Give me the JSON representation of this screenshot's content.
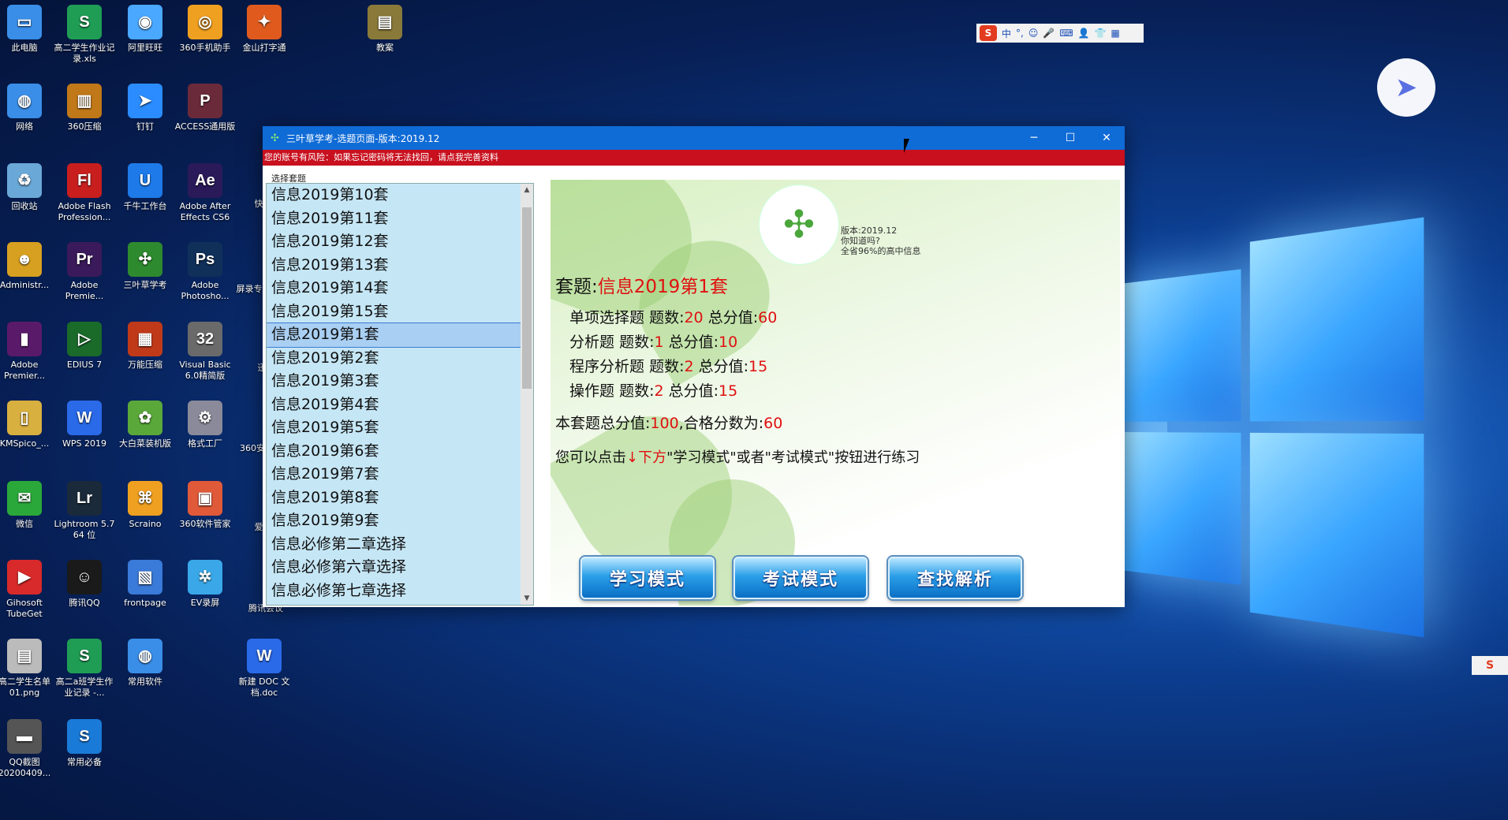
{
  "desktop": {
    "icons": [
      {
        "label": "此电脑",
        "color": "#3a8ee8",
        "glyph": "▭"
      },
      {
        "label": "高二学生作业记录.xls",
        "color": "#1f9d55",
        "glyph": "S"
      },
      {
        "label": "阿里旺旺",
        "color": "#4aa8ff",
        "glyph": "◉"
      },
      {
        "label": "360手机助手",
        "color": "#f0a020",
        "glyph": "◎"
      },
      {
        "label": "金山打字通",
        "color": "#e05a1e",
        "glyph": "✦"
      },
      {
        "label": "教案",
        "color": "#8a7a3a",
        "glyph": "▤"
      },
      {
        "label": "网络",
        "color": "#3a8ee8",
        "glyph": "◍"
      },
      {
        "label": "360压缩",
        "color": "#c07818",
        "glyph": "▥"
      },
      {
        "label": "钉钉",
        "color": "#2a8cff",
        "glyph": "➤"
      },
      {
        "label": "ACCESS通用版",
        "color": "#6a2a3a",
        "glyph": "P"
      },
      {
        "label": "回收站",
        "color": "#6aa8d8",
        "glyph": "♻"
      },
      {
        "label": "Adobe Flash Profession...",
        "color": "#c81e1e",
        "glyph": "Fl"
      },
      {
        "label": "千牛工作台",
        "color": "#1e7ae8",
        "glyph": "U"
      },
      {
        "label": "Adobe After Effects CS6",
        "color": "#2a1a5a",
        "glyph": "Ae"
      },
      {
        "label": "Administr...",
        "color": "#d8a020",
        "glyph": "☻"
      },
      {
        "label": "Adobe Premie...",
        "color": "#3a1a5a",
        "glyph": "Pr"
      },
      {
        "label": "三叶草学考",
        "color": "#2e8a2e",
        "glyph": "✣"
      },
      {
        "label": "Adobe Photosho...",
        "color": "#10305a",
        "glyph": "Ps"
      },
      {
        "label": "Adobe Premier...",
        "color": "#5a1a6a",
        "glyph": "▮"
      },
      {
        "label": "EDIUS 7",
        "color": "#1a6a2a",
        "glyph": "▷"
      },
      {
        "label": "万能压缩",
        "color": "#c03a1a",
        "glyph": "▦"
      },
      {
        "label": "Visual Basic 6.0精简版",
        "color": "#6a6a6a",
        "glyph": "32"
      },
      {
        "label": "KMSpico_...",
        "color": "#d8b040",
        "glyph": "▯"
      },
      {
        "label": "WPS 2019",
        "color": "#2a6ae8",
        "glyph": "W"
      },
      {
        "label": "大白菜装机版",
        "color": "#5aa83a",
        "glyph": "✿"
      },
      {
        "label": "格式工厂",
        "color": "#8a8a9a",
        "glyph": "⚙"
      },
      {
        "label": "微信",
        "color": "#2aa83a",
        "glyph": "✉"
      },
      {
        "label": "Lightroom 5.7 64 位",
        "color": "#1a2a3a",
        "glyph": "Lr"
      },
      {
        "label": "Scraino",
        "color": "#f0a020",
        "glyph": "⌘"
      },
      {
        "label": "360软件管家",
        "color": "#e05a3a",
        "glyph": "▣"
      },
      {
        "label": "Gihosoft TubeGet",
        "color": "#d82a2a",
        "glyph": "▶"
      },
      {
        "label": "腾讯QQ",
        "color": "#1a1a1a",
        "glyph": "☺"
      },
      {
        "label": "frontpage",
        "color": "#3a7ad8",
        "glyph": "▧"
      },
      {
        "label": "EV录屏",
        "color": "#3aa8e8",
        "glyph": "✲"
      },
      {
        "label": "高二学生名单01.png",
        "color": "#bbbbbb",
        "glyph": "▤"
      },
      {
        "label": "高二a班学生作业记录 -...",
        "color": "#1f9d55",
        "glyph": "S"
      },
      {
        "label": "常用软件",
        "color": "#3a8ee8",
        "glyph": "◍"
      },
      {
        "label": "新建 DOC 文档.doc",
        "color": "#2a6ae8",
        "glyph": "W"
      },
      {
        "label": "QQ截图20200409...",
        "color": "#555555",
        "glyph": "▬"
      },
      {
        "label": "常用必备",
        "color": "#1a7ad8",
        "glyph": "S"
      }
    ],
    "partial_labels": [
      "快",
      "屏录专",
      "迅",
      "360安",
      "爱",
      "腾讯会议"
    ]
  },
  "tray": {
    "ime_glyph": "S",
    "ime_items": [
      "中",
      "°,",
      "☺",
      "🎤",
      "⌨",
      "👤",
      "👕",
      "▦"
    ],
    "right_ime": "S"
  },
  "window": {
    "title": "三叶草学考-选题页面-版本:2019.12",
    "controls": {
      "minimize": "─",
      "maximize": "☐",
      "close": "✕"
    },
    "risk_message": "您的账号有风险：如果忘记密码将无法找回，请点我完善资料",
    "group_label": "选择套题",
    "sets": [
      "信息2019第10套",
      "信息2019第11套",
      "信息2019第12套",
      "信息2019第13套",
      "信息2019第14套",
      "信息2019第15套",
      "信息2019第1套",
      "信息2019第2套",
      "信息2019第3套",
      "信息2019第4套",
      "信息2019第5套",
      "信息2019第6套",
      "信息2019第7套",
      "信息2019第8套",
      "信息2019第9套",
      "信息必修第二章选择",
      "信息必修第六章选择",
      "信息必修第七章选择"
    ],
    "selected_index": 6,
    "info": {
      "version": "版本:2019.12",
      "did_you_know": "你知道吗?",
      "coverage": "全省96%的高中信息",
      "set_label": "套题:",
      "set_name": "信息2019第1套",
      "rows": [
        {
          "name": "单项选择题",
          "count_label": "题数:",
          "count": "20",
          "score_label": "总分值:",
          "score": "60"
        },
        {
          "name": "分析题",
          "count_label": "题数:",
          "count": "1",
          "score_label": "总分值:",
          "score": "10"
        },
        {
          "name": "程序分析题",
          "count_label": "题数:",
          "count": "2",
          "score_label": "总分值:",
          "score": "15"
        },
        {
          "name": "操作题",
          "count_label": "题数:",
          "count": "2",
          "score_label": "总分值:",
          "score": "15"
        }
      ],
      "total_prefix": "本套题总分值:",
      "total_score": "100",
      "pass_prefix": ",合格分数为:",
      "pass_score": "60",
      "hint_prefix": "您可以点击",
      "hint_red": "↓下方",
      "hint_suffix": "\"学习模式\"或者\"考试模式\"按钮进行练习"
    },
    "buttons": {
      "study": "学习模式",
      "exam": "考试模式",
      "analysis": "查找解析"
    }
  }
}
